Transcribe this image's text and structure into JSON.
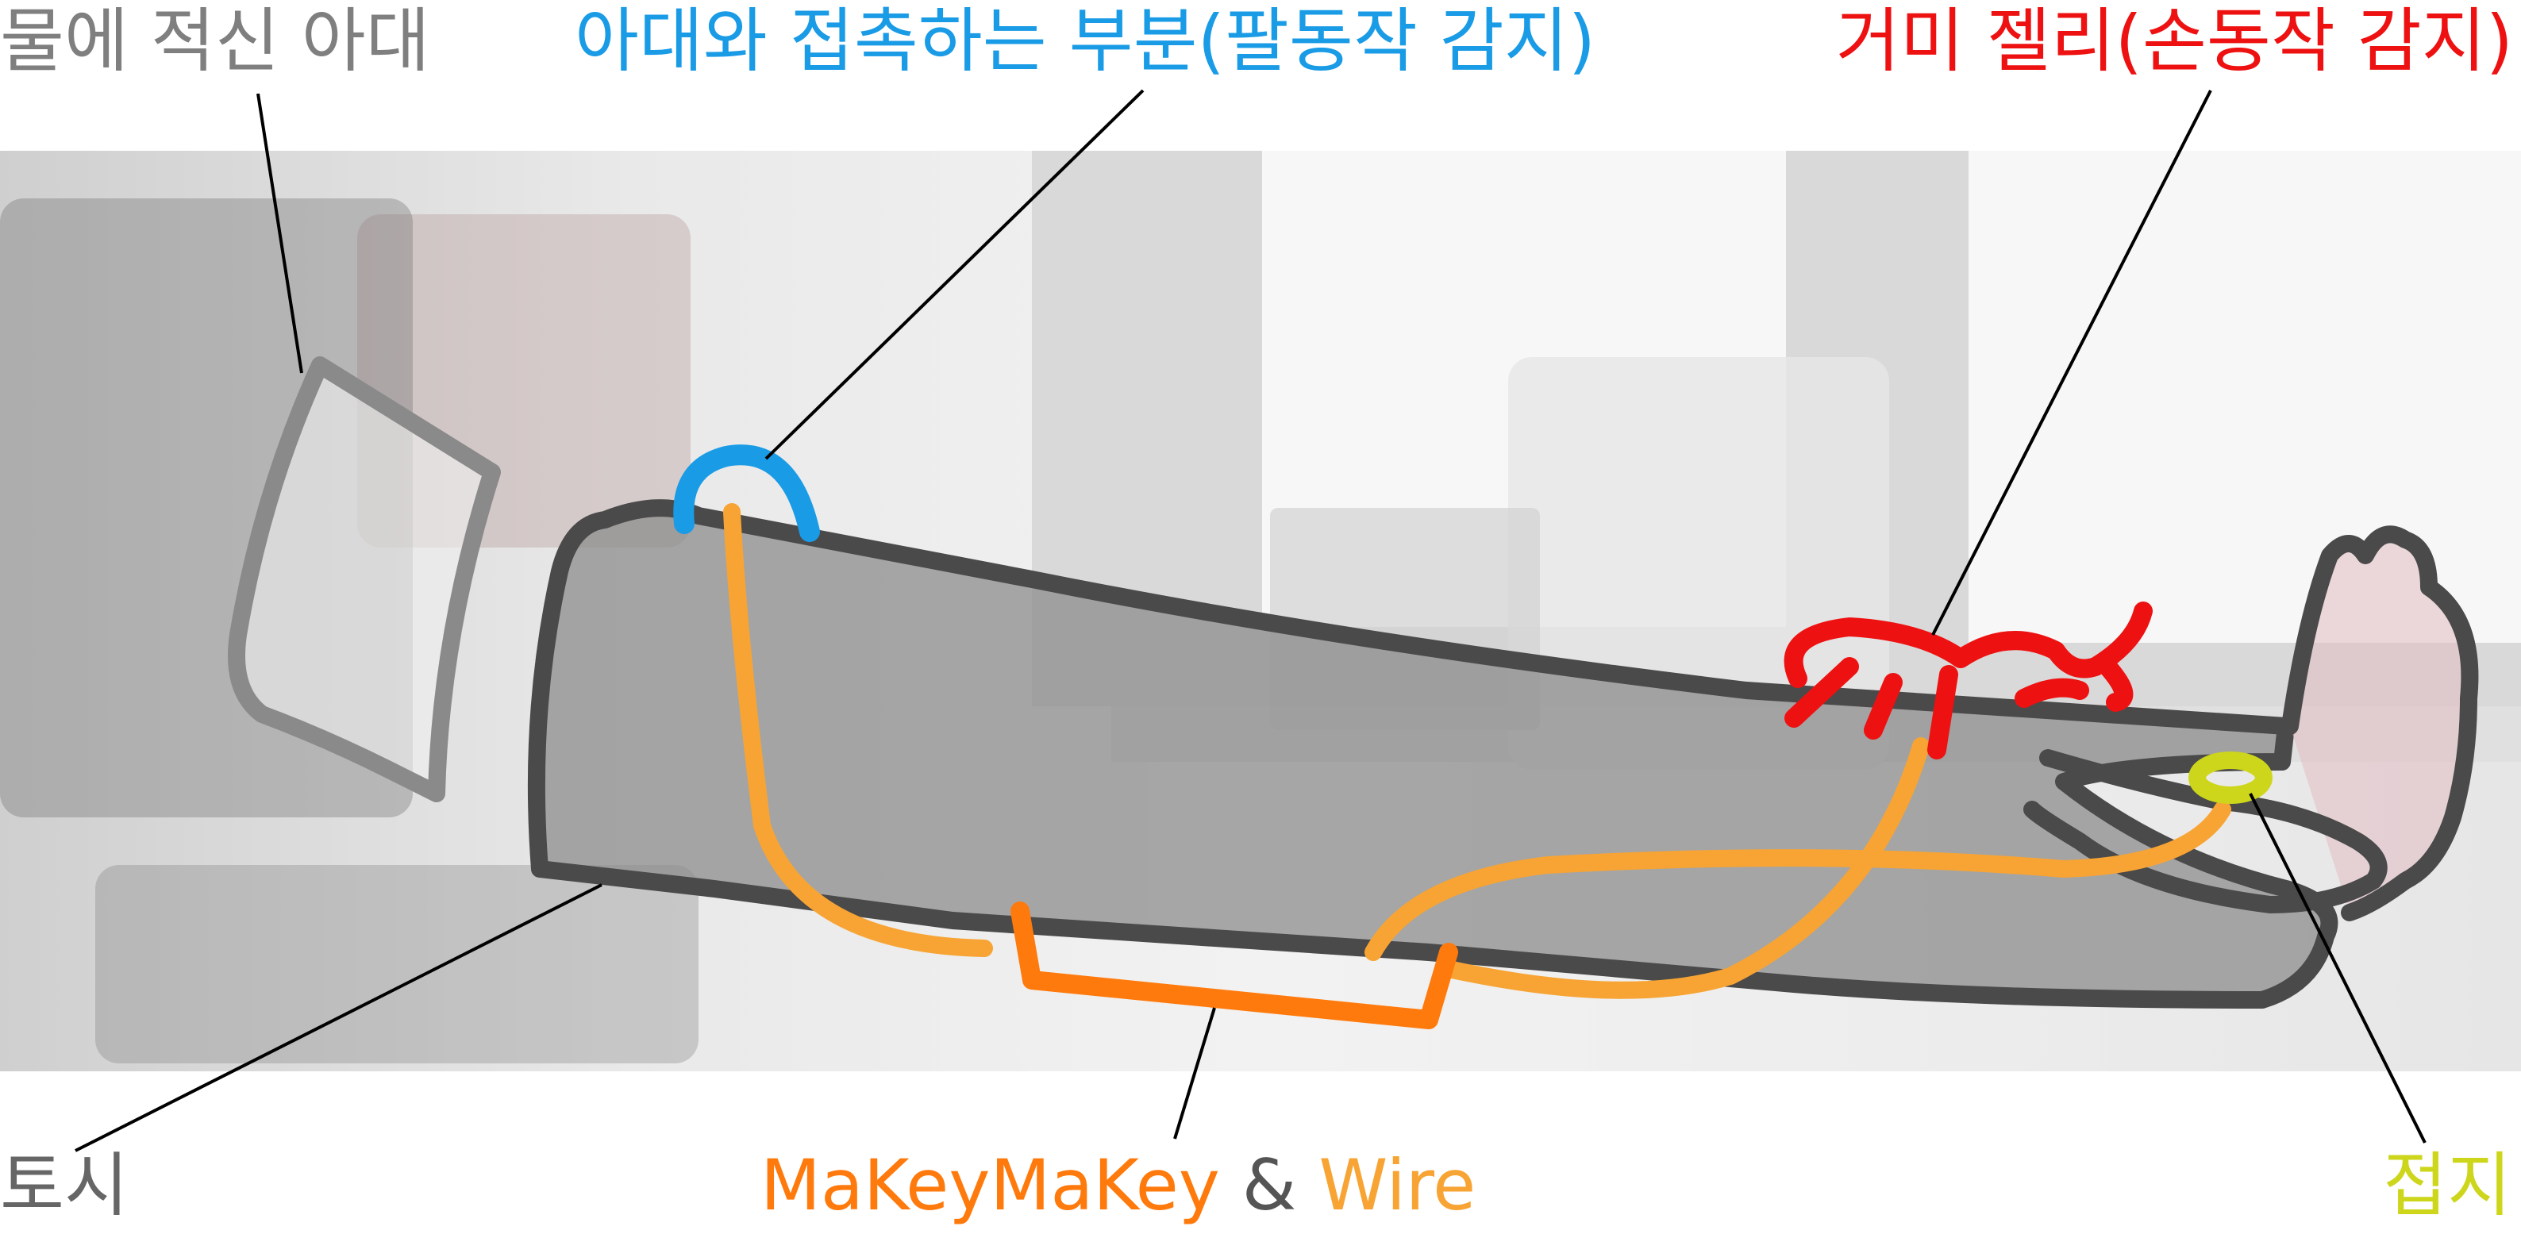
{
  "labels": {
    "wet_forearm": "물에 적신 아대",
    "contact_part": "아대와 접촉하는 부분(팔동작 감지)",
    "gummy_jelly": "거미 젤리(손동작 감지)",
    "toshi": "토시",
    "makey": "MaKeyMaKey",
    "amp": "&",
    "wire": "Wire",
    "index_finger": "접지"
  },
  "colors": {
    "wet_forearm": "#7f7f7f",
    "contact_part": "#1a9be6",
    "gummy_jelly": "#ee1111",
    "toshi": "#666666",
    "makey": "#ff7a0c",
    "wire": "#f7a434",
    "index_finger": "#cdd61b",
    "arm_outline": "#4a4a4a",
    "sleeve_fill": "#8c8c8c"
  }
}
